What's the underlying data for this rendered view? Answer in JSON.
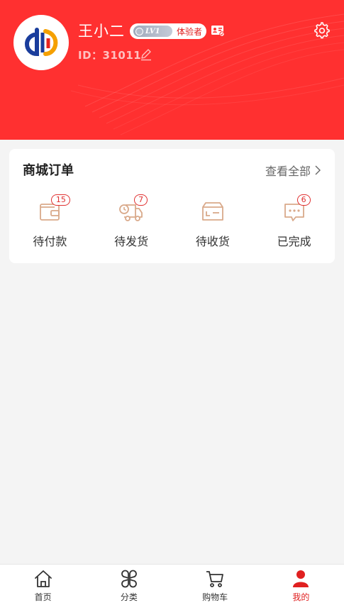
{
  "profile": {
    "username": "王小二",
    "level_code": "LV1",
    "level_name": "体验者",
    "user_id": "ID：31011"
  },
  "orders": {
    "title": "商城订单",
    "view_all": "查看全部",
    "items": [
      {
        "label": "待付款",
        "badge": "15",
        "icon": "wallet-icon"
      },
      {
        "label": "待发货",
        "badge": "7",
        "icon": "delivery-truck-icon"
      },
      {
        "label": "待收货",
        "badge": "",
        "icon": "box-icon"
      },
      {
        "label": "已完成",
        "badge": "6",
        "icon": "chat-bubble-icon"
      }
    ]
  },
  "tabbar": {
    "items": [
      {
        "label": "首页",
        "icon": "home-icon",
        "active": false
      },
      {
        "label": "分类",
        "icon": "category-icon",
        "active": false
      },
      {
        "label": "购物车",
        "icon": "cart-icon",
        "active": false
      },
      {
        "label": "我的",
        "icon": "user-icon",
        "active": true
      }
    ]
  },
  "colors": {
    "brand_red": "#ff3030",
    "active_tab": "#e02020",
    "order_icon": "#d9a98a"
  }
}
